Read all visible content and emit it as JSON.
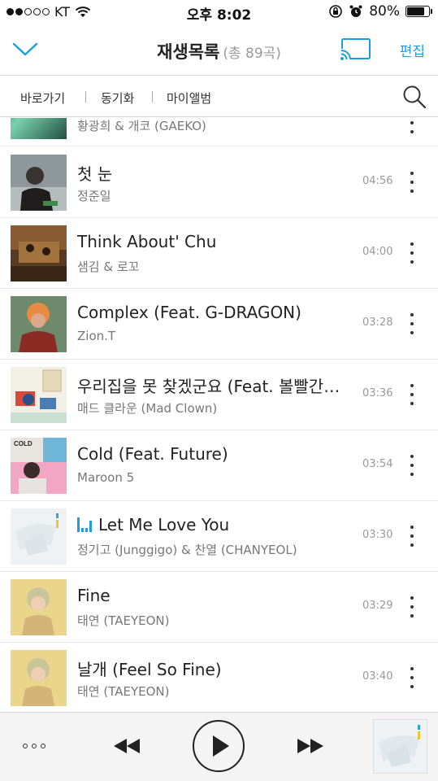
{
  "status_bar": {
    "carrier": "KT",
    "time": "오후 8:02",
    "battery_percent": "80%",
    "battery_level": 0.8
  },
  "header": {
    "title": "재생목록",
    "count": "(총 89곡)",
    "edit_label": "편집",
    "accent_color": "#1a9ee0"
  },
  "nav": {
    "items": [
      "바로가기",
      "동기화",
      "마이앨범"
    ]
  },
  "playlist": {
    "partial_artist": "황광희 & 개코 (GAEKO)",
    "songs": [
      {
        "title": "첫 눈",
        "artist": "정준일",
        "duration": "04:56",
        "art": "gray-portrait"
      },
      {
        "title": "Think About' Chu",
        "artist": "샘김 & 로꼬",
        "duration": "04:00",
        "art": "brown-room"
      },
      {
        "title": "Complex (Feat. G-DRAGON)",
        "artist": "Zion.T",
        "duration": "03:28",
        "art": "red-portrait"
      },
      {
        "title": "우리집을 못 찾겠군요 (Feat. 볼빨간사춘기)",
        "artist": "매드 클라운 (Mad Clown)",
        "duration": "03:36",
        "art": "illustration"
      },
      {
        "title": "Cold (Feat. Future)",
        "artist": "Maroon 5",
        "duration": "03:54",
        "art": "pink-collage"
      },
      {
        "title": "Let Me Love You",
        "artist": "정기고 (Junggigo) & 찬열 (CHANYEOL)",
        "duration": "03:30",
        "art": "white-abstract",
        "playing": true
      },
      {
        "title": "Fine",
        "artist": "태연 (TAEYEON)",
        "duration": "03:29",
        "art": "yellow-portrait"
      },
      {
        "title": "날개 (Feel So Fine)",
        "artist": "태연 (TAEYEON)",
        "duration": "03:40",
        "art": "yellow-portrait"
      }
    ]
  },
  "player": {
    "icons": [
      "more-icon",
      "previous-icon",
      "play-icon",
      "next-icon"
    ]
  }
}
